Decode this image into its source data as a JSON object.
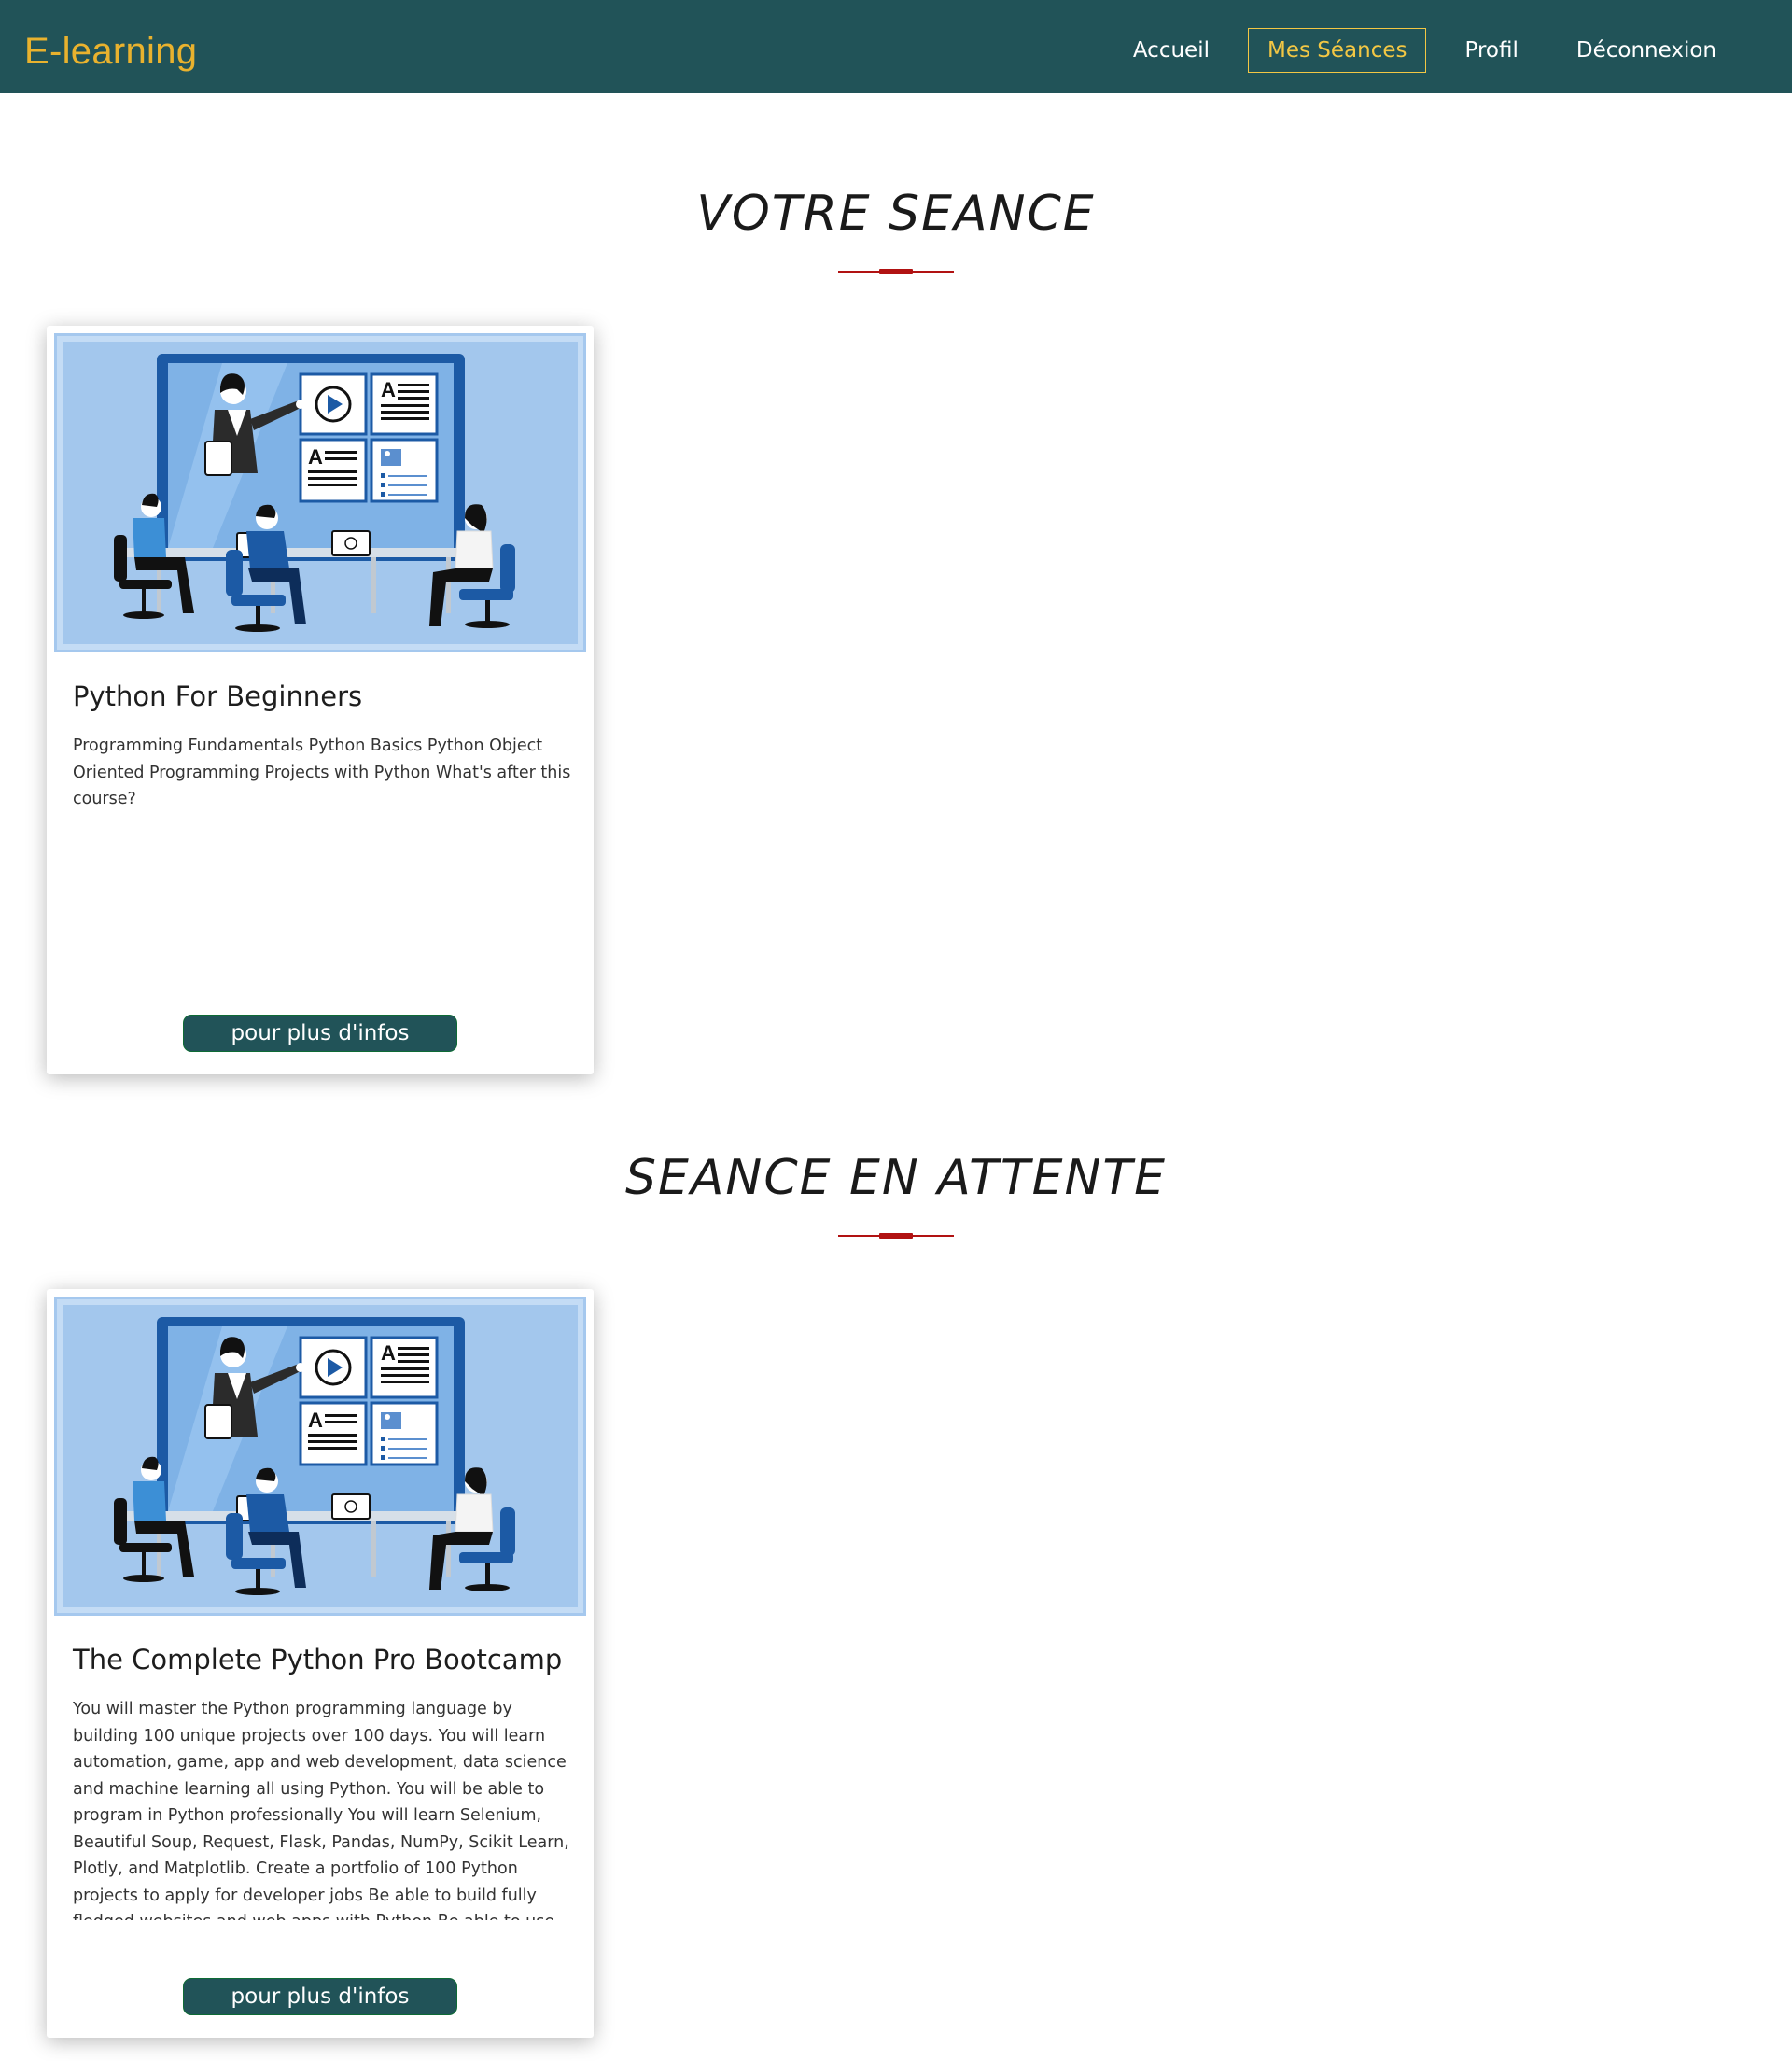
{
  "brand": "E-learning",
  "nav": {
    "home": "Accueil",
    "sessions": "Mes Séances",
    "profile": "Profil",
    "logout": "Déconnexion"
  },
  "sections": [
    {
      "title": "VOTRE SEANCE",
      "courses": [
        {
          "title": "Python For Beginners",
          "description": "Programming Fundamentals Python Basics Python Object Oriented Programming Projects with Python What's after this course?",
          "button": "pour plus d'infos"
        }
      ]
    },
    {
      "title": "SEANCE EN ATTENTE",
      "courses": [
        {
          "title": "The Complete Python Pro Bootcamp",
          "description": "You will master the Python programming language by building 100 unique projects over 100 days. You will learn automation, game, app and web development, data science and machine learning all using Python. You will be able to program in Python professionally You will learn Selenium, Beautiful Soup, Request, Flask, Pandas, NumPy, Scikit Learn, Plotly, and Matplotlib. Create a portfolio of 100 Python projects to apply for developer jobs Be able to build fully fledged websites and web apps with Python Be able to use Python for data science",
          "button": "pour plus d'infos"
        }
      ]
    }
  ],
  "colors": {
    "navbar": "#215358",
    "brand": "#e9b22e",
    "active_nav": "#f3c744",
    "accent_rule": "#b11212",
    "button": "#215358"
  },
  "icons": [
    "play-icon",
    "text-document-icon",
    "image-document-icon",
    "list-document-icon"
  ]
}
